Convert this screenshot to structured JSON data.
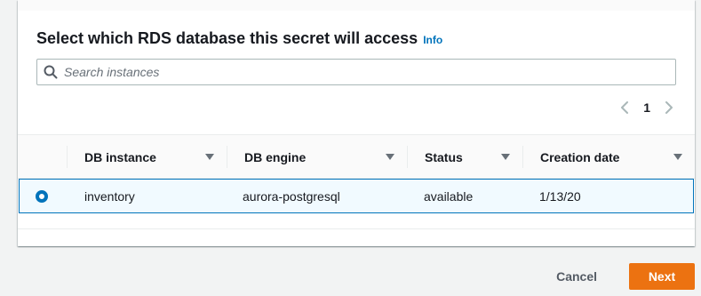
{
  "section": {
    "title": "Select which RDS database this secret will access",
    "info_label": "Info"
  },
  "search": {
    "placeholder": "Search instances",
    "value": ""
  },
  "pagination": {
    "current_page": "1"
  },
  "table": {
    "columns": [
      "DB instance",
      "DB engine",
      "Status",
      "Creation date"
    ],
    "rows": [
      {
        "selected": true,
        "db_instance": "inventory",
        "db_engine": "aurora-postgresql",
        "status": "available",
        "creation_date": "1/13/20"
      }
    ]
  },
  "footer": {
    "cancel_label": "Cancel",
    "next_label": "Next"
  },
  "colors": {
    "accent": "#0073bb",
    "primary_button": "#ec7211",
    "selected_row_bg": "#f1faff"
  },
  "icons": [
    "search-icon",
    "chevron-left-icon",
    "chevron-right-icon",
    "sort-caret-icon",
    "radio-selected-icon"
  ]
}
